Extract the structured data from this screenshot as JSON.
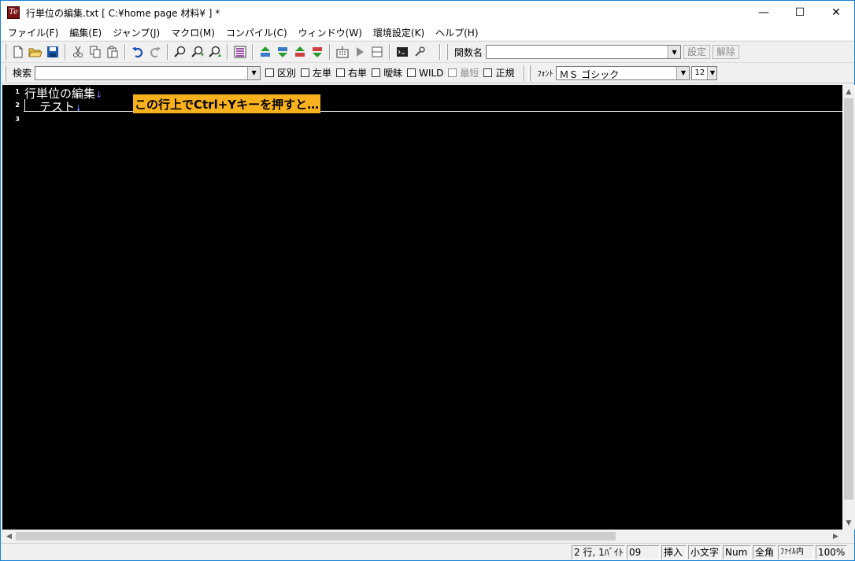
{
  "window": {
    "title": "行単位の編集.txt [ C:¥home page 材料¥ ] *",
    "app_icon_glyph": "Te",
    "minimize_glyph": "—",
    "maximize_glyph": "☐",
    "close_glyph": "✕"
  },
  "menu": [
    {
      "label": "ファイル(F)"
    },
    {
      "label": "編集(E)"
    },
    {
      "label": "ジャンプ(J)"
    },
    {
      "label": "マクロ(M)"
    },
    {
      "label": "コンパイル(C)"
    },
    {
      "label": "ウィンドウ(W)"
    },
    {
      "label": "環境設定(K)"
    },
    {
      "label": "ヘルプ(H)"
    }
  ],
  "toolbar1": {
    "function_label": "関数名",
    "function_value": "",
    "set_button": "設定",
    "release_button": "解除"
  },
  "toolbar2": {
    "search_label": "検索",
    "search_value": "",
    "options": [
      {
        "label": "区別",
        "disabled": false
      },
      {
        "label": "左単",
        "disabled": false
      },
      {
        "label": "右単",
        "disabled": false
      },
      {
        "label": "曖昧",
        "disabled": false
      },
      {
        "label": "WILD",
        "disabled": false
      },
      {
        "label": "最短",
        "disabled": true
      },
      {
        "label": "正規",
        "disabled": false
      }
    ],
    "font_label": "ﾌｫﾝﾄ",
    "font_value": "ＭＳ ゴシック",
    "font_size": "12"
  },
  "editor": {
    "lines": [
      {
        "num": "1",
        "text": "行単位の編集",
        "eol": "↓"
      },
      {
        "num": "2",
        "text": "    テスト",
        "eol": "↓"
      },
      {
        "num": "3",
        "text": "",
        "eol": ""
      }
    ],
    "annotation": "この行上でCtrl+Yキーを押すと…"
  },
  "status": {
    "position": "2 行, 1ﾊﾞｲﾄ",
    "code": "09",
    "insert": "挿入",
    "case": "小文字",
    "num": "Num",
    "width": "全角",
    "scope": "ﾌｧｲﾙ内",
    "zoom": "100%"
  },
  "icons": [
    "new-file-icon",
    "open-folder-icon",
    "save-icon",
    "cut-icon",
    "copy-icon",
    "paste-icon",
    "undo-icon",
    "redo-icon",
    "find-icon",
    "find-next-icon",
    "find-prev-icon",
    "grep-icon",
    "jump-up-icon",
    "jump-down-icon",
    "mark-up-icon",
    "mark-down-icon",
    "macro-icon",
    "run-icon",
    "split-icon",
    "console-icon",
    "tool-icon"
  ]
}
